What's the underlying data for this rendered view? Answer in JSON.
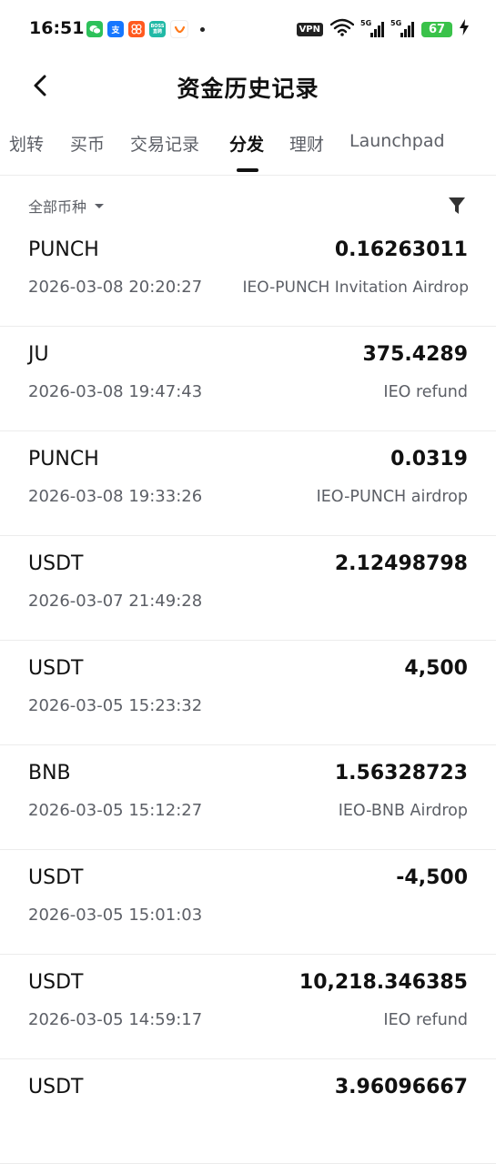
{
  "status_bar": {
    "time": "16:51",
    "vpn": "VPN",
    "network_1": "5G",
    "network_2": "5G",
    "battery": "67",
    "boss_icon_label": "BOSS 直聘"
  },
  "header": {
    "title": "资金历史记录"
  },
  "tabs": [
    {
      "label": "划转",
      "active": false
    },
    {
      "label": "买币",
      "active": false
    },
    {
      "label": "交易记录",
      "active": false
    },
    {
      "label": "分发",
      "active": true
    },
    {
      "label": "理财",
      "active": false
    },
    {
      "label": "Launchpad",
      "active": false
    }
  ],
  "filter": {
    "currency_label": "全部币种"
  },
  "records": [
    {
      "coin": "PUNCH",
      "amount": "0.16263011",
      "time": "2026-03-08 20:20:27",
      "note": "IEO-PUNCH Invitation Airdrop"
    },
    {
      "coin": "JU",
      "amount": "375.4289",
      "time": "2026-03-08 19:47:43",
      "note": "IEO refund"
    },
    {
      "coin": "PUNCH",
      "amount": "0.0319",
      "time": "2026-03-08 19:33:26",
      "note": "IEO-PUNCH airdrop"
    },
    {
      "coin": "USDT",
      "amount": "2.12498798",
      "time": "2026-03-07 21:49:28",
      "note": ""
    },
    {
      "coin": "USDT",
      "amount": "4,500",
      "time": "2026-03-05 15:23:32",
      "note": ""
    },
    {
      "coin": "BNB",
      "amount": "1.56328723",
      "time": "2026-03-05 15:12:27",
      "note": "IEO-BNB Airdrop"
    },
    {
      "coin": "USDT",
      "amount": "-4,500",
      "time": "2026-03-05 15:01:03",
      "note": ""
    },
    {
      "coin": "USDT",
      "amount": "10,218.346385",
      "time": "2026-03-05 14:59:17",
      "note": "IEO refund"
    },
    {
      "coin": "USDT",
      "amount": "3.96096667",
      "time": "",
      "note": ""
    }
  ],
  "icons": {
    "back": "chevron-left-icon",
    "filter": "funnel-icon",
    "caret": "caret-down-icon"
  },
  "colors": {
    "text_primary": "#111111",
    "text_secondary": "#5c5f66",
    "divider": "#ececec",
    "battery": "#3ac24a"
  }
}
